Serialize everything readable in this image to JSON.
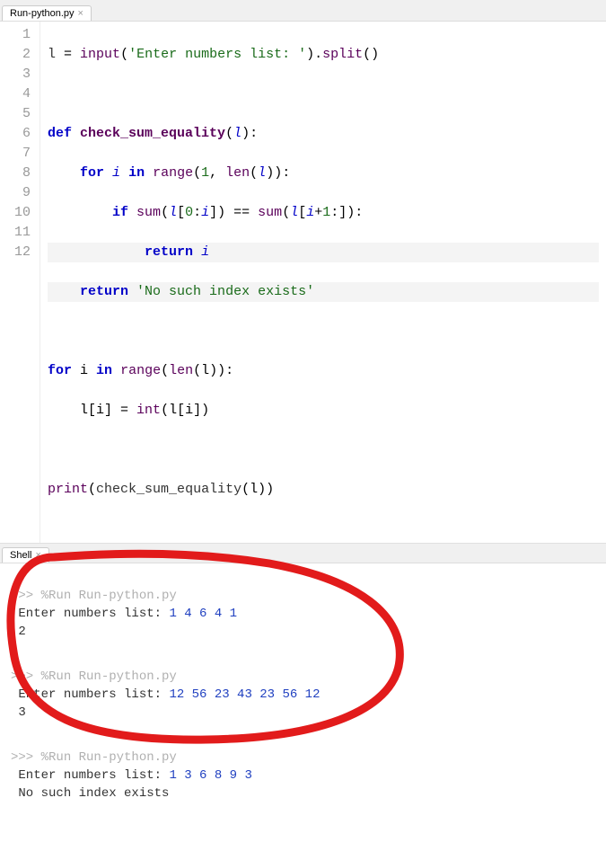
{
  "editor_tab": {
    "filename": "Run-python.py"
  },
  "gutter": [
    "1",
    "2",
    "3",
    "4",
    "5",
    "6",
    "7",
    "8",
    "9",
    "10",
    "11",
    "12"
  ],
  "code": {
    "l1_var": "l",
    "l1_assign": " = ",
    "l1_fn": "input",
    "l1_paren_o": "(",
    "l1_str": "'Enter numbers list: '",
    "l1_paren_c": ").",
    "l1_split": "split",
    "l1_end": "()",
    "l3_def": "def ",
    "l3_name": "check_sum_equality",
    "l3_sig1": "(",
    "l3_arg": "l",
    "l3_sig2": "):",
    "l4_ind": "    ",
    "l4_for": "for ",
    "l4_i": "i",
    "l4_in": " in ",
    "l4_range": "range",
    "l4_open": "(",
    "l4_one": "1",
    "l4_comma": ", ",
    "l4_len": "len",
    "l4_open2": "(",
    "l4_l": "l",
    "l4_close": ")):",
    "l5_ind": "        ",
    "l5_if": "if ",
    "l5_sum1": "sum",
    "l5_b1": "(",
    "l5_l1": "l",
    "l5_sl1": "[",
    "l5_zero": "0",
    "l5_colon": ":",
    "l5_i1": "i",
    "l5_sl1c": "]) == ",
    "l5_sum2": "sum",
    "l5_b2": "(",
    "l5_l2": "l",
    "l5_sl2": "[",
    "l5_i2": "i",
    "l5_plus": "+",
    "l5_one": "1",
    "l5_sl2c": ":]):",
    "l6_ind": "            ",
    "l6_ret": "return ",
    "l6_i": "i",
    "l7_ind": "    ",
    "l7_ret": "return ",
    "l7_str": "'No such index exists'",
    "l9_for": "for ",
    "l9_i": "i ",
    "l9_in": "in ",
    "l9_range": "range",
    "l9_open": "(",
    "l9_len": "len",
    "l9_open2": "(l)):",
    "l10_ind": "    ",
    "l10_li": "l[i] = ",
    "l10_int": "int",
    "l10_arg": "(l[i])",
    "l12_print": "print",
    "l12_open": "(",
    "l12_fn": "check_sum_equality",
    "l12_arg": "(l))"
  },
  "shell_tab": {
    "label": "Shell"
  },
  "shell": {
    "prompt": ">>> ",
    "run_cmd": "%Run Run-python.py",
    "prompt_text": "Enter numbers list: ",
    "runs": [
      {
        "input": "1 4 6 4 1",
        "output": "2"
      },
      {
        "input": "12 56 23 43 23 56 12",
        "output": "3"
      },
      {
        "input": "1 3 6 8 9 3",
        "output": "No such index exists"
      }
    ]
  }
}
